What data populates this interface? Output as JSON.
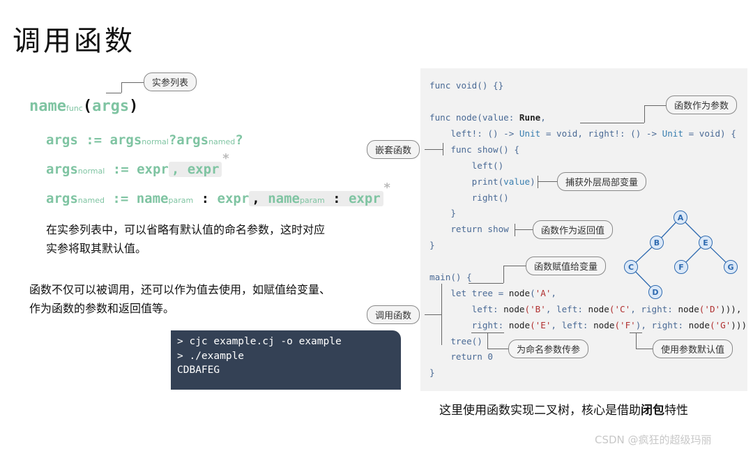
{
  "title": "调用函数",
  "syntax": {
    "actual_param_label": "实参列表",
    "line1": {
      "name": "name",
      "sub": "func",
      "open": "(",
      "args": "args",
      "close": ")"
    },
    "line2": {
      "args": "args",
      "op": " := ",
      "normal": "args",
      "normal_sub": "normal",
      "q1": "?",
      "named": "args",
      "named_sub": "named",
      "q2": "?"
    },
    "line3": {
      "lhs": "args",
      "lhs_sub": "normal",
      "op": " := ",
      "expr": "expr",
      "rep": ", expr",
      "star": "*"
    },
    "line4": {
      "lhs": "args",
      "lhs_sub": "named",
      "op": " := ",
      "name": "name",
      "name_sub": "param",
      "colon": " : ",
      "expr": "expr",
      "rep_sep": ",",
      "rep_name": "name",
      "rep_name_sub": "param",
      "rep_colon": " : ",
      "rep_expr": "expr",
      "star": "*"
    }
  },
  "para1": [
    "在实参列表中，可以省略有默认值的命名参数，这时对应",
    "实参将取其默认值。"
  ],
  "para2": [
    "函数不仅可以被调用，还可以作为值去使用，如赋值给变量、",
    "作为函数的参数和返回值等。"
  ],
  "terminal": [
    "> cjc example.cj -o example",
    "> ./example",
    "CDBAFEG"
  ],
  "code": {
    "l1": "func void() {}",
    "l2_a": "func node(value: ",
    "l2_type": "Rune",
    "l2_b": ",",
    "l3_a": "    left!: () -> ",
    "l3_unit1": "Unit",
    "l3_b": " = void, right!: () -> ",
    "l3_unit2": "Unit",
    "l3_c": " = void) {",
    "l4": "    func show() {",
    "l5": "        left()",
    "l6_a": "        print(",
    "l6_b": "value",
    "l6_c": ")",
    "l7": "        right()",
    "l8": "    }",
    "l9_a": "    return ",
    "l9_b": "show",
    "l10": "}",
    "l11": "main() {",
    "l12_a": "    let tree = ",
    "l12_fn": "node",
    "l12_b": "(",
    "l12_s": "'A'",
    "l12_c": ",",
    "l13_a": "        left: ",
    "l13_fn1": "node",
    "l13_s1": "('B'",
    "l13_b": ", left: ",
    "l13_fn2": "node",
    "l13_s2": "('C'",
    "l13_c": ", right: ",
    "l13_fn3": "node",
    "l13_s3": "('D'",
    "l13_d": "))),",
    "l14_a": "        right: ",
    "l14_fn1": "node",
    "l14_s1": "('E'",
    "l14_b": ", left: ",
    "l14_fn2": "node",
    "l14_s2": "('F'",
    "l14_c": "), right: ",
    "l14_fn3": "node",
    "l14_s3": "('G'",
    "l14_d": ")))",
    "l15": "    tree()",
    "l16": "    return 0",
    "l17": "}"
  },
  "annotations": {
    "func_as_param": "函数作为参数",
    "nested_func": "嵌套函数",
    "capture_var": "捕获外层局部变量",
    "func_as_return": "函数作为返回值",
    "func_assign": "函数赋值给变量",
    "call_func": "调用函数",
    "named_param_pass": "为命名参数传参",
    "default_value": "使用参数默认值"
  },
  "tree_nodes": [
    "A",
    "B",
    "E",
    "C",
    "F",
    "G",
    "D"
  ],
  "caption": {
    "a": "这里使用函数实现二叉树，核心是借助",
    "b": "闭包",
    "c": "特性"
  },
  "watermark": "CSDN @疯狂的超级玛丽"
}
